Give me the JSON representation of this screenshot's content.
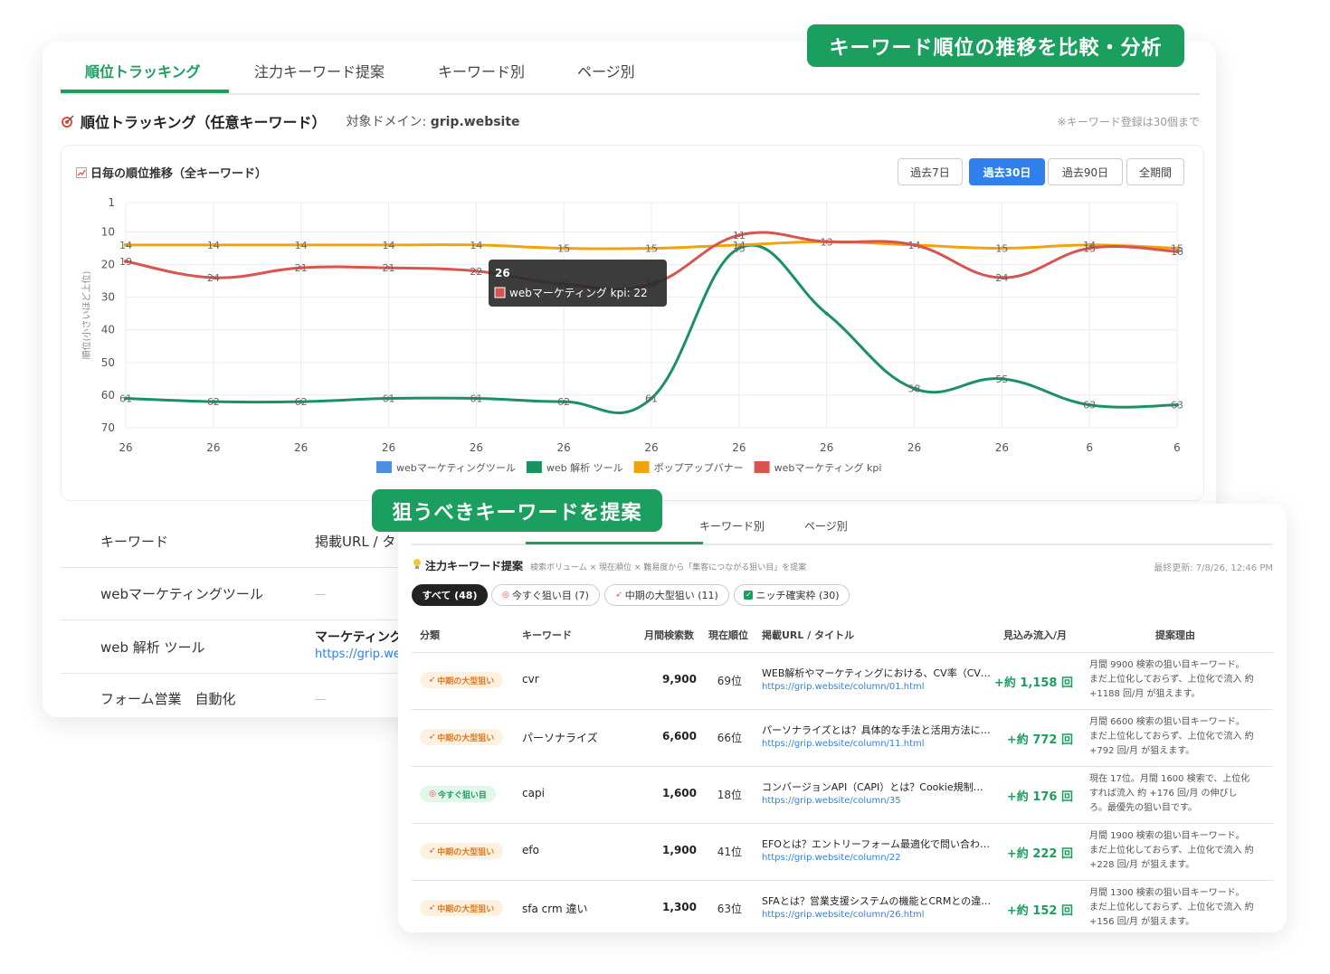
{
  "callouts": {
    "top": "キーワード順位の推移を比較・分析",
    "middle": "狙うべきキーワードを提案"
  },
  "main_tabs": [
    "順位トラッキング",
    "注力キーワード提案",
    "キーワード別",
    "ページ別"
  ],
  "section": {
    "icon": "target-icon",
    "title": "順位トラッキング（任意キーワード）",
    "domain_label": "対象ドメイン:",
    "domain": "grip.website",
    "note": "※キーワード登録は30個まで"
  },
  "chart_panel": {
    "icon": "chart-icon",
    "title": "日毎の順位推移（全キーワード）",
    "ranges": [
      "過去7日",
      "過去30日",
      "過去90日",
      "全期間"
    ],
    "active_range": "過去30日"
  },
  "chart_data": {
    "type": "line",
    "ylabel": "順位(小さいほど上位)",
    "y_reversed": true,
    "ylim": [
      1,
      70
    ],
    "y_ticks": [
      1,
      10,
      20,
      30,
      40,
      50,
      60,
      70
    ],
    "categories": [
      "26",
      "26",
      "26",
      "26",
      "26",
      "26",
      "26",
      "26",
      "26",
      "26",
      "26",
      "6",
      "6"
    ],
    "series": [
      {
        "name": "webマーケティングツール",
        "color": "#4a90e2",
        "values": []
      },
      {
        "name": "web 解析 ツール",
        "color": "#1a9160",
        "values": [
          61,
          62,
          62,
          61,
          61,
          62,
          61,
          15,
          35,
          58,
          55,
          63,
          63
        ]
      },
      {
        "name": "ポップアップバナー",
        "color": "#f0a30a",
        "values": [
          14,
          14,
          14,
          14,
          14,
          15,
          15,
          14,
          13,
          14,
          15,
          14,
          15
        ]
      },
      {
        "name": "webマーケティング kpi",
        "color": "#d9534f",
        "values": [
          19,
          24,
          21,
          21,
          22,
          26,
          26,
          11,
          13,
          14,
          24,
          15,
          16
        ]
      }
    ],
    "point_labels": {
      "web 解析 ツール": [
        "61",
        "62",
        "62",
        "61",
        "61",
        "62",
        "61",
        "15",
        "",
        "58",
        "55",
        "63",
        "63"
      ],
      "ポップアップバナー": [
        "14",
        "14",
        "14",
        "14",
        "14",
        "15",
        "15",
        "14",
        "13",
        "14",
        "15",
        "14",
        "15"
      ],
      "webマーケティング kpi": [
        "19",
        "24",
        "21",
        "21",
        "22",
        "26",
        "16",
        "11",
        "",
        "",
        "24",
        "15",
        "16"
      ]
    },
    "legend_position": "bottom",
    "grid": true,
    "tooltip": {
      "title": "26",
      "text": "webマーケティング kpi: 22"
    }
  },
  "keyword_table": {
    "headers": [
      "キーワード",
      "掲載URL / タ"
    ],
    "rows": [
      {
        "keyword": "webマーケティングツール",
        "url_title": "—",
        "url": ""
      },
      {
        "keyword": "web 解析 ツール",
        "url_title": "マーケティング",
        "url": "https://grip.we"
      },
      {
        "keyword": "フォーム営業　自動化",
        "url_title": "—",
        "url": ""
      }
    ]
  },
  "proposal": {
    "tabs": [
      "キーワード別",
      "ページ別"
    ],
    "icon": "lightbulb-icon",
    "title": "注力キーワード提案",
    "subtitle": "検索ボリューム × 現在順位 × 難易度から「集客につながる狙い目」を提案",
    "updated": "最終更新: 7/8/26, 12:46 PM",
    "filters": [
      "すべて (48)",
      "今すぐ狙い目 (7)",
      "中期の大型狙い (11)",
      "ニッチ確実枠 (30)"
    ],
    "headers": [
      "分類",
      "キーワード",
      "月間検索数",
      "現在順位",
      "掲載URL / タイトル",
      "見込み流入/月",
      "提案理由"
    ],
    "rows": [
      {
        "category": "中期の大型狙い",
        "type": "mid",
        "keyword": "cvr",
        "volume": "9,900",
        "rank": "69位",
        "title": "WEB解析やマーケティングにおける、CV率（CV…",
        "url": "https://grip.website/column/01.html",
        "inflow": "+約 1,158 回",
        "reason": [
          "月間 9900 検索の狙い目キーワード。",
          "まだ上位化しておらず、上位化で流入 約",
          "+1188 回/月 が狙えます。"
        ]
      },
      {
        "category": "中期の大型狙い",
        "type": "mid",
        "keyword": "パーソナライズ",
        "volume": "6,600",
        "rank": "66位",
        "title": "パーソナライズとは？具体的な手法と活用方法に…",
        "url": "https://grip.website/column/11.html",
        "inflow": "+約 772 回",
        "reason": [
          "月間 6600 検索の狙い目キーワード。",
          "まだ上位化しておらず、上位化で流入 約",
          "+792 回/月 が狙えます。"
        ]
      },
      {
        "category": "今すぐ狙い目",
        "type": "now",
        "keyword": "capi",
        "volume": "1,600",
        "rank": "18位",
        "title": "コンバージョンAPI（CAPI）とは？Cookie規制…",
        "url": "https://grip.website/column/35",
        "inflow": "+約 176 回",
        "reason": [
          "現在 17位。月間 1600 検索で、上位化",
          "すれば流入 約 +176 回/月 の伸びし",
          "ろ。最優先の狙い目です。"
        ]
      },
      {
        "category": "中期の大型狙い",
        "type": "mid",
        "keyword": "efo",
        "volume": "1,900",
        "rank": "41位",
        "title": "EFOとは？エントリーフォーム最適化で問い合わ…",
        "url": "https://grip.website/column/22",
        "inflow": "+約 222 回",
        "reason": [
          "月間 1900 検索の狙い目キーワード。",
          "まだ上位化しておらず、上位化で流入 約",
          "+228 回/月 が狙えます。"
        ]
      },
      {
        "category": "中期の大型狙い",
        "type": "mid",
        "keyword": "sfa crm 違い",
        "volume": "1,300",
        "rank": "63位",
        "title": "SFAとは？営業支援システムの機能とCRMとの違…",
        "url": "https://grip.website/column/26.html",
        "inflow": "+約 152 回",
        "reason": [
          "月間 1300 検索の狙い目キーワード。",
          "まだ上位化しておらず、上位化で流入 約",
          "+156 回/月 が狙えます。"
        ]
      }
    ]
  }
}
